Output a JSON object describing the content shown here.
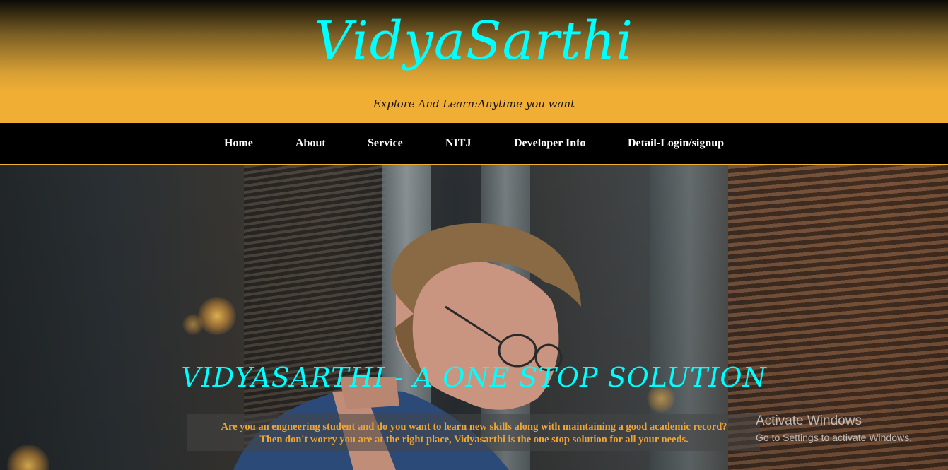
{
  "header": {
    "brand": "VidyaSarthi",
    "tagline": "Explore And Learn:Anytime you want"
  },
  "nav": {
    "items": [
      {
        "label": "Home"
      },
      {
        "label": "About"
      },
      {
        "label": "Service"
      },
      {
        "label": "NITJ"
      },
      {
        "label": "Developer Info"
      },
      {
        "label": "Detail-Login/signup"
      }
    ]
  },
  "hero": {
    "title": "VIDYASARTHI - A ONE STOP SOLUTION",
    "line1": "Are you an engneering student and do you want to learn new skills along with maintaining a good academic record?",
    "line2": "Then don't worry you are at the right place, Vidyasarthi is the one stop solution for all your needs."
  },
  "watermark": {
    "title": "Activate Windows",
    "subtitle": "Go to Settings to activate Windows."
  },
  "colors": {
    "brand": "#00ffff",
    "accent": "#f1ae35",
    "nav_bg": "#000000",
    "hero_text": "#f1a530"
  }
}
